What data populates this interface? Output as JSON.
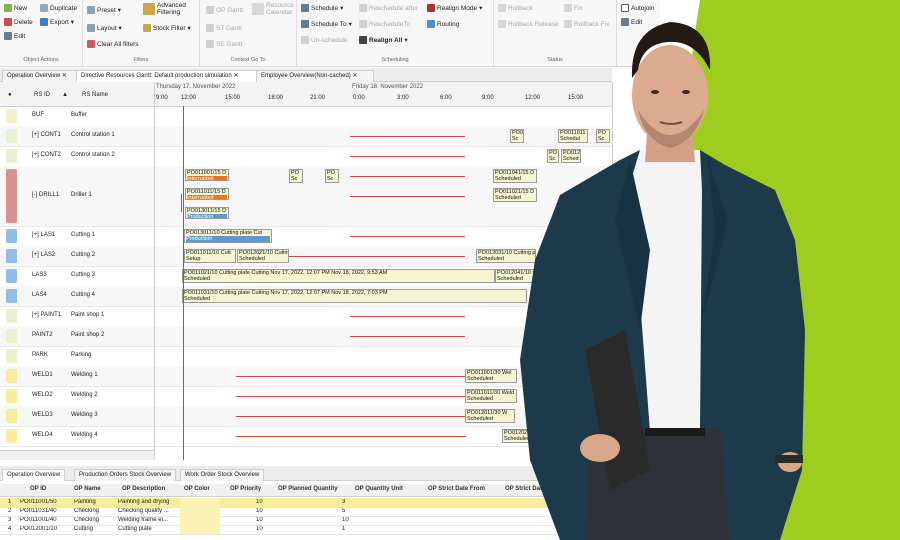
{
  "colors": {
    "accent_green": "#9fcd1f",
    "bar_yellow": "#f6f3c8",
    "bar_orange": "#e8761e",
    "bar_blue": "#5b9bd5",
    "timeline_red": "#c9302c"
  },
  "ribbon": {
    "object_actions": {
      "label": "Object Actions",
      "new": "New",
      "duplicate": "Duplicate",
      "delete": "Delete",
      "export": "Export",
      "edit": "Edit"
    },
    "filters": {
      "label": "Filters",
      "preset": "Preset",
      "advanced_filtering": "Advanced\nFiltering",
      "layout": "Layout",
      "stock_filter": "Stock Filter",
      "clear_all_filters": "Clear All filters"
    },
    "context_go_to": {
      "label": "Context Go To",
      "op_gantt": "OP Gantt",
      "st_gantt": "ST Gantt",
      "resource_calendar": "Resource\nCalendar",
      "se_gantt": "SE Gantt"
    },
    "scheduling": {
      "label": "Scheduling",
      "schedule": "Schedule",
      "reschedule_after": "Reschedule after",
      "realign_mode": "Realign Mode",
      "schedule_to": "Schedule To",
      "reschedule_to": "RescheduleTo",
      "routing": "Routing",
      "un_schedule": "Un-schedule",
      "realign_all": "Realign All"
    },
    "status": {
      "label": "Status",
      "rollback": "Rollback",
      "fix": "Fix",
      "rollback_release": "Rollback Release",
      "rollback_fix": "Rollback Fix"
    },
    "autojoin": "Autojoin",
    "edit_partial": "Edit"
  },
  "doc_tabs": [
    "Operation Overview",
    "Directive Resources Gantt: Default production simulation",
    "Employee Overview(Non-cached)"
  ],
  "gantt": {
    "headers": {
      "rs_id": "RS ID",
      "rs_name": "RS Name",
      "day1": "Thursday 17. November 2022",
      "day2": "Friday 18. November 2022"
    },
    "times": [
      "9:00",
      "12:00",
      "15:00",
      "18:00",
      "21:00",
      "0:00",
      "3:00",
      "6:00",
      "9:00",
      "12:00",
      "15:00"
    ],
    "rows": [
      {
        "id": "BUF",
        "name": "Buffer",
        "color": "#f2eed2"
      },
      {
        "id": "[+] CONT1",
        "name": "Control station 1",
        "color": "#e7f1cf"
      },
      {
        "id": "[+] CONT2",
        "name": "Control station 2",
        "color": "#e7f1cf"
      },
      {
        "id": "[-] DRILL1",
        "name": "Driller 1",
        "color": "#d89090"
      },
      {
        "id": "[+] LAS1",
        "name": "Cutting 1",
        "color": "#8fbde6"
      },
      {
        "id": "[+] LAS2",
        "name": "Cutting 2",
        "color": "#8fbde6"
      },
      {
        "id": "LAS3",
        "name": "Cutting 3",
        "color": "#8fbde6"
      },
      {
        "id": "LAS4",
        "name": "Cutting 4",
        "color": "#8fbde6"
      },
      {
        "id": "[+] PAINT1",
        "name": "Paint shop 1",
        "color": "#e7f1cf"
      },
      {
        "id": "PAINT2",
        "name": "Paint shop 2",
        "color": "#e7f1cf"
      },
      {
        "id": "PARK",
        "name": "Parking",
        "color": "#e7f1cf"
      },
      {
        "id": "WELD1",
        "name": "Welding 1",
        "color": "#f6ec9b"
      },
      {
        "id": "WELD2",
        "name": "Welding 2",
        "color": "#f6ec9b"
      },
      {
        "id": "WELD3",
        "name": "Welding 3",
        "color": "#f6ec9b"
      },
      {
        "id": "WELD4",
        "name": "Welding 4",
        "color": "#f6ec9b"
      }
    ],
    "bars": {
      "cont1_a": {
        "t": "PO0",
        "s": "Sc"
      },
      "cont1_b": {
        "t": "PO011011",
        "s": "Schedul"
      },
      "cont1_c": {
        "t": "PO",
        "s": "Sc"
      },
      "cont2_a": {
        "t": "PO",
        "s": "Sc"
      },
      "cont2_b": {
        "t": "PO012",
        "s": "Sched"
      },
      "drill_a": {
        "t": "PO011001/15 D",
        "s": "Interrupted"
      },
      "drill_b": {
        "t": "PO",
        "s": "Sc"
      },
      "drill_c": {
        "t": "PO",
        "s": "Sc"
      },
      "drill_d": {
        "t": "PO011011/15 D",
        "s": "Interrupted"
      },
      "drill_e": {
        "t": "PO013011/15 D",
        "s": "Production"
      },
      "drill_f": {
        "t": "PO011041/15 D",
        "s": "Scheduled"
      },
      "drill_g": {
        "t": "PO011021/15 D",
        "s": "Scheduled"
      },
      "las1_a": {
        "t": "PO013011/10 Cutting plate Cut",
        "s": "Production"
      },
      "las2_a": {
        "t": "PO011011/10 Cutt",
        "s": "Setup"
      },
      "las2_b": {
        "t": "PO012021/10 Cutting pla",
        "s": "Scheduled"
      },
      "las2_c": {
        "t": "PO012031/10 Cutting pla",
        "s": "Scheduled"
      },
      "las3_a": {
        "t": "PO011021/10 Cutting plate Cutting Nov 17, 2022, 12:07 PM Nov 18, 2022, 9:53 AM",
        "s": "Scheduled"
      },
      "las3_b": {
        "t": "PO012041/10 Cutt",
        "s": "Scheduled"
      },
      "las4_a": {
        "t": "PO011031/10 Cutting plate Cutting Nov 17, 2022, 12:07 PM Nov 18, 2022, 7:03 PM",
        "s": "Scheduled"
      },
      "weld1_a": {
        "t": "PO011001/30 Wel",
        "s": "Scheduled"
      },
      "weld2_a": {
        "t": "PO011011/30 Weld",
        "s": "Scheduled"
      },
      "weld3_a": {
        "t": "PO012011/30 W",
        "s": "Scheduled"
      },
      "weld4_a": {
        "t": "PO012021/30",
        "s": "Scheduled"
      }
    }
  },
  "bottom_tabs": [
    "Operation Overview",
    "Production Orders Stock Overview",
    "Work Order Stock Overview"
  ],
  "table": {
    "headers": [
      "OP ID",
      "OP Name",
      "OP Description",
      "OP Color",
      "OP Priority",
      "OP Planned Quantity",
      "OP Quantity Unit",
      "OP Strict Date From",
      "OP Strict Date T"
    ],
    "rows": [
      {
        "n": "1",
        "id": "PO011001/50",
        "name": "Painting",
        "desc": "Painting and drying",
        "pri": "10",
        "qty": "3"
      },
      {
        "n": "2",
        "id": "PO011031/40",
        "name": "Checking",
        "desc": "Checking quality ...",
        "pri": "10",
        "qty": "5"
      },
      {
        "n": "3",
        "id": "PO011001/40",
        "name": "Checking",
        "desc": "Welding frame el...",
        "pri": "10",
        "qty": "10"
      },
      {
        "n": "4",
        "id": "PO012001/10",
        "name": "Cutting",
        "desc": "Cutting plate",
        "pri": "10",
        "qty": "1"
      }
    ]
  }
}
